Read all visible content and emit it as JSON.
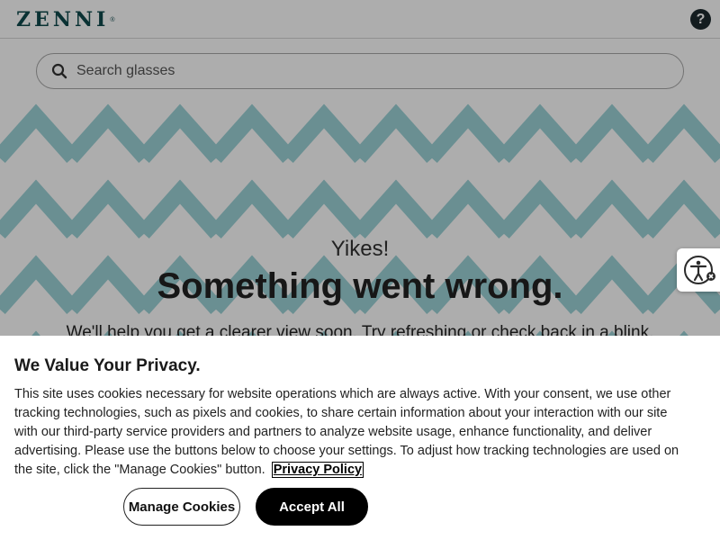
{
  "header": {
    "logo_text": "ZENNI",
    "logo_mark": "®",
    "help_icon": "question-circle-icon",
    "help_glyph": "?"
  },
  "search": {
    "placeholder": "Search glasses",
    "icon": "search-icon"
  },
  "hero": {
    "kicker": "Yikes!",
    "title": "Something went wrong.",
    "message": "We'll help you get a clearer view soon. Try refreshing or check back in a blink."
  },
  "accessibility_widget": {
    "icon": "accessibility-icon"
  },
  "cookie_banner": {
    "title": "We Value Your Privacy.",
    "body": "This site uses cookies necessary for website operations which are always active. With your consent, we use other tracking technologies, such as pixels and cookies, to share certain information about your interaction with our site with our third-party service providers and partners to analyze website usage, enhance functionality, and deliver advertising. Please use the buttons below to choose your settings. To adjust how tracking technologies are used on the site, click the \"Manage Cookies\" button.",
    "privacy_link": "Privacy Policy",
    "manage_label": "Manage Cookies",
    "accept_label": "Accept All"
  },
  "colors": {
    "brand": "#0f4a4d",
    "pattern": "#9cd3d8",
    "button_dark": "#000000"
  }
}
